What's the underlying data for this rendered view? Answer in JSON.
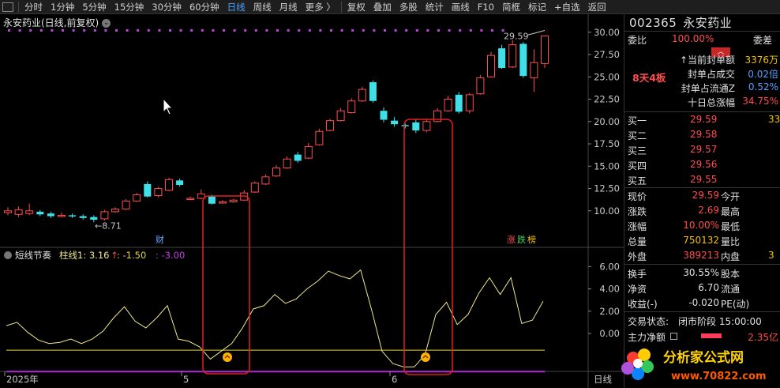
{
  "toolbar": {
    "items": [
      "分时",
      "1分钟",
      "5分钟",
      "15分钟",
      "30分钟",
      "60分钟",
      "日线",
      "周线",
      "月线",
      "更多",
      "复权",
      "叠加",
      "多股",
      "统计",
      "画线",
      "F10",
      "简框",
      "标记",
      "+自选",
      "返回"
    ],
    "more_suffix": "〉",
    "active": "日线"
  },
  "main_chart": {
    "title": "永安药业(日线,前复权)",
    "y_ticks": [
      "30.00",
      "27.50",
      "25.00",
      "22.50",
      "20.00",
      "17.50",
      "15.00",
      "12.50",
      "10.00"
    ],
    "high_label": "29.59",
    "low_label": "8.71",
    "cai_label": "财",
    "zhang_label": "涨",
    "die_label": "跌",
    "bang_label": "榜"
  },
  "indicator": {
    "name": "短线节奏",
    "series_label": "柱线1: 3.16",
    "arrow": "↑",
    "val2": ": -1.50",
    "val3": ": -3.00",
    "y_ticks": [
      "6.00",
      "4.00",
      "2.00",
      "0.00"
    ]
  },
  "x_axis": {
    "labels": [
      "2025年",
      "5",
      "6"
    ],
    "right_label": "日线"
  },
  "colors": {
    "up": "#ff4d4d",
    "down": "#3fe0e8",
    "indicator_line": "#f0e68c",
    "yellow_line": "#e6d23a",
    "purple_line": "#b02ad8",
    "dots": "#c040e0",
    "highlight_box": "#e02020"
  },
  "chart_data": {
    "type": "candlestick",
    "ylim": [
      7.5,
      31
    ],
    "candles": [
      {
        "o": 9.8,
        "c": 10.0,
        "h": 10.4,
        "l": 9.5
      },
      {
        "o": 9.6,
        "c": 10.1,
        "h": 10.5,
        "l": 9.3
      },
      {
        "o": 9.7,
        "c": 10.0,
        "h": 10.8,
        "l": 9.5
      },
      {
        "o": 9.9,
        "c": 9.6,
        "h": 10.1,
        "l": 9.4
      },
      {
        "o": 9.7,
        "c": 9.4,
        "h": 9.9,
        "l": 9.2
      },
      {
        "o": 9.4,
        "c": 9.5,
        "h": 9.8,
        "l": 9.3
      },
      {
        "o": 9.5,
        "c": 9.4,
        "h": 9.7,
        "l": 9.2
      },
      {
        "o": 9.4,
        "c": 9.2,
        "h": 9.6,
        "l": 9.0
      },
      {
        "o": 9.3,
        "c": 9.0,
        "h": 9.5,
        "l": 8.71
      },
      {
        "o": 9.1,
        "c": 9.9,
        "h": 10.1,
        "l": 8.9
      },
      {
        "o": 9.9,
        "c": 10.2,
        "h": 10.4,
        "l": 9.8
      },
      {
        "o": 10.2,
        "c": 11.1,
        "h": 11.3,
        "l": 10.1
      },
      {
        "o": 11.1,
        "c": 11.8,
        "h": 12.0,
        "l": 11.0
      },
      {
        "o": 13.0,
        "c": 11.6,
        "h": 13.3,
        "l": 11.5
      },
      {
        "o": 11.7,
        "c": 12.5,
        "h": 12.7,
        "l": 11.5
      },
      {
        "o": 12.3,
        "c": 13.5,
        "h": 13.7,
        "l": 12.2
      },
      {
        "o": 13.4,
        "c": 12.9,
        "h": 13.6,
        "l": 12.7
      },
      {
        "o": 11.4,
        "c": 11.4,
        "h": 11.6,
        "l": 11.2
      },
      {
        "o": 11.4,
        "c": 11.9,
        "h": 12.4,
        "l": 11.3
      },
      {
        "o": 11.6,
        "c": 10.8,
        "h": 11.8,
        "l": 10.7
      },
      {
        "o": 10.9,
        "c": 11.0,
        "h": 11.2,
        "l": 10.8
      },
      {
        "o": 11.0,
        "c": 11.2,
        "h": 11.3,
        "l": 10.9
      },
      {
        "o": 11.2,
        "c": 12.0,
        "h": 12.3,
        "l": 11.1
      },
      {
        "o": 12.1,
        "c": 13.1,
        "h": 13.3,
        "l": 12.0
      },
      {
        "o": 13.0,
        "c": 13.8,
        "h": 14.1,
        "l": 12.9
      },
      {
        "o": 13.9,
        "c": 14.8,
        "h": 15.1,
        "l": 13.8
      },
      {
        "o": 14.8,
        "c": 15.8,
        "h": 16.1,
        "l": 14.7
      },
      {
        "o": 16.3,
        "c": 15.6,
        "h": 16.6,
        "l": 15.4
      },
      {
        "o": 15.9,
        "c": 17.2,
        "h": 17.6,
        "l": 15.8
      },
      {
        "o": 17.4,
        "c": 18.9,
        "h": 19.2,
        "l": 17.3
      },
      {
        "o": 19.0,
        "c": 20.1,
        "h": 20.3,
        "l": 18.9
      },
      {
        "o": 20.1,
        "c": 21.2,
        "h": 21.5,
        "l": 20.0
      },
      {
        "o": 21.0,
        "c": 22.3,
        "h": 22.6,
        "l": 20.9
      },
      {
        "o": 22.3,
        "c": 23.6,
        "h": 23.9,
        "l": 22.2
      },
      {
        "o": 24.4,
        "c": 22.3,
        "h": 24.6,
        "l": 22.1
      },
      {
        "o": 21.2,
        "c": 20.2,
        "h": 21.6,
        "l": 19.9
      },
      {
        "o": 20.1,
        "c": 19.7,
        "h": 20.5,
        "l": 19.4
      },
      {
        "o": 19.6,
        "c": 19.5,
        "h": 19.8,
        "l": 19.2
      },
      {
        "o": 19.9,
        "c": 19.0,
        "h": 20.3,
        "l": 18.7
      },
      {
        "o": 19.0,
        "c": 20.0,
        "h": 20.3,
        "l": 18.8
      },
      {
        "o": 20.0,
        "c": 21.2,
        "h": 21.5,
        "l": 19.9
      },
      {
        "o": 21.2,
        "c": 22.5,
        "h": 22.9,
        "l": 21.1
      },
      {
        "o": 23.0,
        "c": 21.1,
        "h": 23.3,
        "l": 20.9
      },
      {
        "o": 21.2,
        "c": 23.0,
        "h": 23.2,
        "l": 20.9
      },
      {
        "o": 23.1,
        "c": 24.9,
        "h": 25.2,
        "l": 23.0
      },
      {
        "o": 25.0,
        "c": 27.4,
        "h": 27.8,
        "l": 24.9
      },
      {
        "o": 28.2,
        "c": 26.0,
        "h": 28.6,
        "l": 25.9
      },
      {
        "o": 26.1,
        "c": 28.6,
        "h": 29.1,
        "l": 26.0
      },
      {
        "o": 28.7,
        "c": 25.1,
        "h": 28.9,
        "l": 24.9
      },
      {
        "o": 24.9,
        "c": 26.6,
        "h": 28.1,
        "l": 23.3
      },
      {
        "o": 26.5,
        "c": 29.59,
        "h": 29.59,
        "l": 26.0
      }
    ],
    "indicator_ylim": [
      -3.5,
      6.5
    ],
    "indicator_values": [
      0.7,
      1.0,
      0.1,
      -0.6,
      -0.9,
      -0.8,
      -0.5,
      -0.9,
      -0.5,
      0.2,
      1.4,
      2.4,
      1.1,
      0.5,
      1.4,
      2.5,
      -0.5,
      -0.7,
      -1.2,
      -2.3,
      -1.6,
      -0.9,
      0.5,
      2.2,
      2.5,
      3.5,
      2.7,
      3.1,
      4.0,
      4.7,
      5.6,
      5.2,
      4.9,
      5.7,
      2.2,
      -1.6,
      -2.7,
      -3.0,
      -3.0,
      -1.9,
      1.7,
      2.8,
      0.8,
      1.7,
      3.6,
      5.0,
      3.5,
      5.0,
      0.9,
      1.2,
      2.9
    ],
    "yellow_level": -1.5,
    "purple_level": -3.0
  },
  "right_panel": {
    "code": "002365",
    "name": "永安药业",
    "weibi_label": "委比",
    "weibi_value": "100.00%",
    "weicha_label": "委差",
    "board_tag": "8天4板",
    "info_rows": [
      {
        "label": "当前封单额",
        "value": "3376万"
      },
      {
        "label": "封单占成交",
        "value": "0.02倍"
      },
      {
        "label": "封单占流通Z",
        "value": "0.52%"
      },
      {
        "label": "十日总涨幅",
        "value": "34.75%"
      }
    ],
    "bids": [
      {
        "label": "买一",
        "price": "29.59",
        "vol": "33"
      },
      {
        "label": "买二",
        "price": "29.58",
        "vol": ""
      },
      {
        "label": "买三",
        "price": "29.57",
        "vol": ""
      },
      {
        "label": "买四",
        "price": "29.56",
        "vol": ""
      },
      {
        "label": "买五",
        "price": "29.55",
        "vol": ""
      }
    ],
    "quote": [
      {
        "l1": "现价",
        "v1": "29.59",
        "l2": "今开",
        "c": "red"
      },
      {
        "l1": "涨跌",
        "v1": "2.69",
        "l2": "最高",
        "c": "red"
      },
      {
        "l1": "涨幅",
        "v1": "10.00%",
        "l2": "最低",
        "c": "red"
      },
      {
        "l1": "总量",
        "v1": "750132",
        "l2": "量比",
        "c": "yellow"
      },
      {
        "l1": "外盘",
        "v1": "389213",
        "l2": "内盘",
        "c": "red"
      }
    ],
    "waipan_extra": "3",
    "stats": [
      {
        "l1": "换手",
        "v1": "30.55%",
        "l2": "股本"
      },
      {
        "l1": "净资",
        "v1": "6.70",
        "l2": "流通"
      },
      {
        "l1": "收益(-)",
        "v1": "-0.020",
        "l2": "PE(动)"
      }
    ],
    "status_label": "交易状态:",
    "status_value": "闭市阶段 15:00:00",
    "zhuli_label": "主力净额",
    "zhuli_value": "2.35亿"
  },
  "logo": {
    "text": "分析家公式网",
    "url": "www.70822.com"
  }
}
